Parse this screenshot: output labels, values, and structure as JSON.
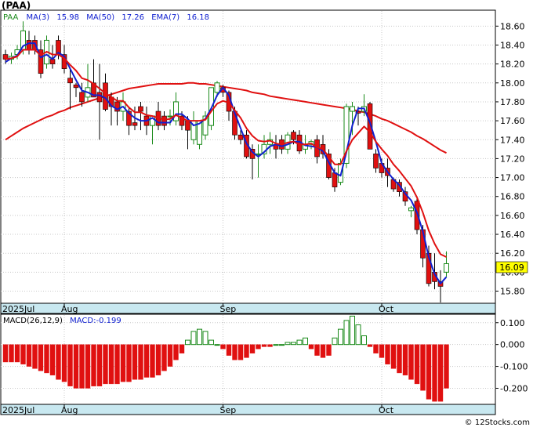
{
  "title": "(PAA)",
  "legend": {
    "ticker": "PAA",
    "ma3_label": "MA(3)",
    "ma3_value": "15.98",
    "ma50_label": "MA(50)",
    "ma50_value": "17.26",
    "ema7_label": "EMA(7)",
    "ema7_value": "16.18"
  },
  "macd_legend": {
    "params_label": "MACD(26,12,9)",
    "value_label": "MACD:-0.199"
  },
  "last_price_tag": "16.09",
  "watermark": "© 12Stocks.com",
  "colors": {
    "up": "#1a8a1a",
    "down": "#e01010",
    "ma_fast": "#1020d0",
    "ma_slow": "#e01010",
    "band": "#c8e8f0",
    "price_tag": "#ffff00"
  },
  "chart_data": [
    {
      "type": "candlestick",
      "title": "(PAA)",
      "ylim": [
        15.68,
        18.76
      ],
      "y_ticks": [
        "18.60",
        "18.40",
        "18.20",
        "18.00",
        "17.80",
        "17.60",
        "17.40",
        "17.20",
        "17.00",
        "16.80",
        "16.60",
        "16.40",
        "16.20",
        "16.00",
        "15.80"
      ],
      "x_labels": [
        "2025Jul",
        "Aug",
        "Sep",
        "Oct"
      ],
      "grid": true,
      "candles": [
        [
          18.3,
          18.35,
          18.2,
          18.25
        ],
        [
          18.25,
          18.32,
          18.2,
          18.28
        ],
        [
          18.3,
          18.4,
          18.25,
          18.35
        ],
        [
          18.35,
          18.65,
          18.3,
          18.55
        ],
        [
          18.45,
          18.55,
          18.3,
          18.35
        ],
        [
          18.45,
          18.5,
          18.3,
          18.35
        ],
        [
          18.35,
          18.45,
          18.05,
          18.1
        ],
        [
          18.2,
          18.5,
          18.15,
          18.45
        ],
        [
          18.25,
          18.4,
          18.15,
          18.2
        ],
        [
          18.45,
          18.5,
          18.25,
          18.3
        ],
        [
          18.3,
          18.4,
          18.1,
          18.15
        ],
        [
          18.05,
          18.15,
          17.72,
          18.0
        ],
        [
          17.98,
          18.0,
          17.85,
          17.95
        ],
        [
          17.9,
          18.0,
          17.75,
          17.8
        ],
        [
          17.85,
          18.2,
          17.8,
          17.95
        ],
        [
          18.0,
          18.25,
          17.85,
          17.85
        ],
        [
          17.9,
          18.2,
          17.4,
          17.8
        ],
        [
          18.0,
          18.1,
          17.7,
          17.72
        ],
        [
          17.85,
          17.9,
          17.55,
          17.75
        ],
        [
          17.8,
          17.85,
          17.55,
          17.7
        ],
        [
          17.7,
          17.9,
          17.6,
          17.8
        ],
        [
          17.7,
          17.75,
          17.45,
          17.55
        ],
        [
          17.58,
          17.75,
          17.5,
          17.55
        ],
        [
          17.75,
          17.8,
          17.5,
          17.7
        ],
        [
          17.65,
          17.75,
          17.45,
          17.55
        ],
        [
          17.55,
          17.6,
          17.35,
          17.65
        ],
        [
          17.7,
          17.8,
          17.5,
          17.55
        ],
        [
          17.65,
          17.7,
          17.5,
          17.55
        ],
        [
          17.65,
          17.72,
          17.55,
          17.65
        ],
        [
          17.6,
          17.9,
          17.55,
          17.8
        ],
        [
          17.65,
          17.7,
          17.5,
          17.55
        ],
        [
          17.6,
          17.65,
          17.3,
          17.5
        ],
        [
          17.4,
          17.7,
          17.35,
          17.6
        ],
        [
          17.35,
          17.6,
          17.3,
          17.6
        ],
        [
          17.45,
          17.7,
          17.4,
          17.65
        ],
        [
          17.55,
          17.95,
          17.5,
          17.95
        ],
        [
          17.9,
          18.02,
          17.85,
          18.0
        ],
        [
          17.95,
          17.98,
          17.85,
          17.9
        ],
        [
          17.9,
          17.92,
          17.6,
          17.7
        ],
        [
          17.7,
          17.75,
          17.4,
          17.45
        ],
        [
          17.45,
          17.5,
          17.35,
          17.4
        ],
        [
          17.45,
          17.5,
          17.2,
          17.22
        ],
        [
          17.3,
          17.35,
          16.98,
          17.2
        ],
        [
          17.25,
          17.35,
          17.0,
          17.25
        ],
        [
          17.25,
          17.45,
          17.2,
          17.35
        ],
        [
          17.35,
          17.48,
          17.25,
          17.4
        ],
        [
          17.35,
          17.45,
          17.2,
          17.3
        ],
        [
          17.4,
          17.45,
          17.25,
          17.3
        ],
        [
          17.3,
          17.48,
          17.25,
          17.45
        ],
        [
          17.48,
          17.5,
          17.35,
          17.4
        ],
        [
          17.45,
          17.5,
          17.25,
          17.28
        ],
        [
          17.3,
          17.45,
          17.25,
          17.35
        ],
        [
          17.35,
          17.4,
          17.3,
          17.38
        ],
        [
          17.4,
          17.45,
          17.15,
          17.22
        ],
        [
          17.35,
          17.45,
          17.2,
          17.25
        ],
        [
          17.25,
          17.3,
          16.98,
          17.0
        ],
        [
          17.05,
          17.1,
          16.85,
          16.9
        ],
        [
          16.95,
          17.2,
          16.92,
          17.15
        ],
        [
          17.15,
          17.78,
          17.1,
          17.75
        ],
        [
          17.7,
          17.8,
          17.45,
          17.75
        ],
        [
          17.7,
          17.75,
          17.55,
          17.68
        ],
        [
          17.7,
          17.88,
          17.65,
          17.75
        ],
        [
          17.78,
          17.8,
          17.4,
          17.3
        ],
        [
          17.25,
          17.3,
          17.05,
          17.1
        ],
        [
          17.15,
          17.2,
          17.0,
          17.05
        ],
        [
          17.1,
          17.2,
          16.9,
          17.02
        ],
        [
          16.98,
          17.0,
          16.85,
          16.88
        ],
        [
          16.95,
          16.98,
          16.8,
          16.85
        ],
        [
          16.85,
          16.9,
          16.7,
          16.75
        ],
        [
          16.65,
          16.7,
          16.58,
          16.68
        ],
        [
          16.75,
          16.78,
          16.4,
          16.45
        ],
        [
          16.45,
          16.5,
          16.05,
          16.15
        ],
        [
          16.2,
          16.28,
          15.85,
          15.88
        ],
        [
          16.0,
          16.2,
          15.82,
          15.9
        ],
        [
          15.9,
          16.02,
          15.68,
          15.85
        ],
        [
          16.0,
          16.22,
          15.95,
          16.09
        ]
      ],
      "ma3": [
        18.22,
        18.26,
        18.29,
        18.39,
        18.42,
        18.42,
        18.27,
        18.3,
        18.25,
        18.32,
        18.28,
        18.15,
        18.03,
        17.92,
        17.9,
        17.87,
        17.87,
        17.84,
        17.76,
        17.72,
        17.75,
        17.68,
        17.63,
        17.6,
        17.6,
        17.63,
        17.58,
        17.58,
        17.58,
        17.67,
        17.67,
        17.62,
        17.55,
        17.57,
        17.62,
        17.73,
        17.87,
        17.95,
        17.87,
        17.68,
        17.52,
        17.36,
        17.27,
        17.22,
        17.27,
        17.33,
        17.35,
        17.33,
        17.35,
        17.38,
        17.38,
        17.34,
        17.33,
        17.32,
        17.28,
        17.16,
        17.05,
        17.02,
        17.27,
        17.55,
        17.73,
        17.73,
        17.58,
        17.38,
        17.15,
        17.06,
        16.98,
        16.92,
        16.83,
        16.76,
        16.63,
        16.43,
        16.16,
        15.98,
        15.88,
        15.95
      ],
      "ema7": [
        18.25,
        18.26,
        18.28,
        18.35,
        18.35,
        18.35,
        18.29,
        18.33,
        18.3,
        18.3,
        18.26,
        18.19,
        18.13,
        18.05,
        18.03,
        17.99,
        17.94,
        17.89,
        17.85,
        17.81,
        17.81,
        17.74,
        17.69,
        17.69,
        17.66,
        17.65,
        17.63,
        17.61,
        17.62,
        17.66,
        17.63,
        17.6,
        17.6,
        17.6,
        17.61,
        17.7,
        17.78,
        17.81,
        17.79,
        17.71,
        17.63,
        17.52,
        17.44,
        17.39,
        17.38,
        17.39,
        17.36,
        17.35,
        17.37,
        17.38,
        17.35,
        17.35,
        17.36,
        17.32,
        17.3,
        17.22,
        17.14,
        17.14,
        17.28,
        17.4,
        17.47,
        17.54,
        17.48,
        17.38,
        17.3,
        17.23,
        17.14,
        17.07,
        16.99,
        16.91,
        16.79,
        16.63,
        16.44,
        16.3,
        16.19,
        16.16
      ],
      "ma50": [
        17.4,
        17.44,
        17.48,
        17.52,
        17.55,
        17.58,
        17.61,
        17.64,
        17.66,
        17.69,
        17.71,
        17.74,
        17.76,
        17.78,
        17.8,
        17.82,
        17.84,
        17.86,
        17.88,
        17.9,
        17.92,
        17.94,
        17.95,
        17.96,
        17.97,
        17.98,
        17.99,
        17.99,
        17.99,
        17.99,
        17.99,
        18.0,
        18.0,
        17.99,
        17.99,
        17.98,
        17.97,
        17.96,
        17.95,
        17.94,
        17.93,
        17.92,
        17.9,
        17.89,
        17.88,
        17.86,
        17.85,
        17.84,
        17.83,
        17.82,
        17.81,
        17.8,
        17.79,
        17.78,
        17.77,
        17.76,
        17.75,
        17.74,
        17.73,
        17.72,
        17.7,
        17.69,
        17.67,
        17.65,
        17.62,
        17.6,
        17.57,
        17.54,
        17.51,
        17.48,
        17.44,
        17.41,
        17.37,
        17.33,
        17.29,
        17.26
      ]
    },
    {
      "type": "bar",
      "title": "MACD(26,12,9)",
      "ylim": [
        -0.27,
        0.135
      ],
      "y_ticks": [
        "0.100",
        "0.000",
        "-0.100",
        "-0.200"
      ],
      "x_labels": [
        "2025Jul",
        "Aug",
        "Sep",
        "Oct"
      ],
      "grid": true,
      "values": [
        -0.08,
        -0.08,
        -0.08,
        -0.09,
        -0.1,
        -0.11,
        -0.12,
        -0.13,
        -0.14,
        -0.16,
        -0.17,
        -0.19,
        -0.2,
        -0.2,
        -0.2,
        -0.19,
        -0.19,
        -0.18,
        -0.18,
        -0.18,
        -0.17,
        -0.17,
        -0.16,
        -0.16,
        -0.15,
        -0.15,
        -0.14,
        -0.12,
        -0.1,
        -0.07,
        -0.04,
        0.02,
        0.06,
        0.07,
        0.06,
        0.02,
        0.0,
        -0.02,
        -0.05,
        -0.07,
        -0.07,
        -0.06,
        -0.04,
        -0.02,
        -0.01,
        -0.01,
        0.0,
        0.0,
        0.01,
        0.01,
        0.02,
        0.03,
        -0.02,
        -0.05,
        -0.06,
        -0.05,
        0.03,
        0.07,
        0.11,
        0.13,
        0.09,
        0.04,
        -0.01,
        -0.04,
        -0.06,
        -0.09,
        -0.11,
        -0.13,
        -0.14,
        -0.16,
        -0.18,
        -0.21,
        -0.25,
        -0.26,
        -0.26,
        -0.2
      ]
    }
  ]
}
